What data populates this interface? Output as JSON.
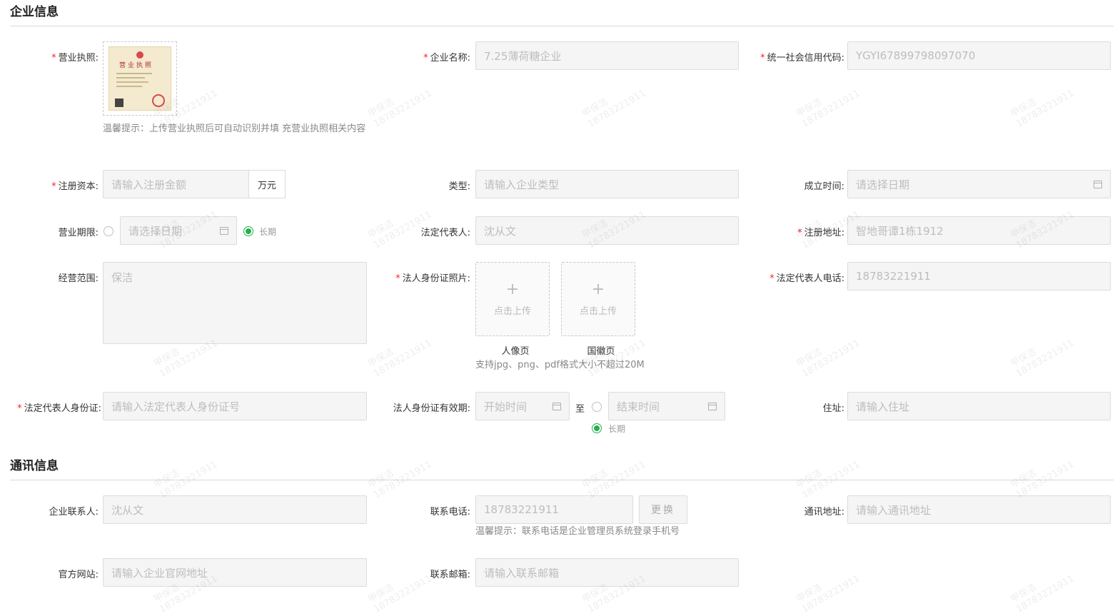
{
  "sections": {
    "company_info": "企业信息",
    "contact_info": "通讯信息"
  },
  "fields": {
    "business_license": {
      "label": "营业执照:",
      "hint": "温馨提示：上传营业执照后可自动识别并填 充营业执照相关内容",
      "seal_text": "营业执照"
    },
    "company_name": {
      "label": "企业名称:",
      "value": "7.25薄荷糖企业"
    },
    "credit_code": {
      "label": "统一社会信用代码:",
      "value": "YGYI67899798097070"
    },
    "registered_capital": {
      "label": "注册资本:",
      "placeholder": "请输入注册金额",
      "unit": "万元"
    },
    "company_type": {
      "label": "类型:",
      "placeholder": "请输入企业类型"
    },
    "founded_date": {
      "label": "成立时间:",
      "placeholder": "请选择日期"
    },
    "business_term": {
      "label": "营业期限:",
      "placeholder": "请选择日期",
      "long_term_label": "长期",
      "selected": "long_term"
    },
    "legal_rep": {
      "label": "法定代表人:",
      "value": "沈从文"
    },
    "registered_address": {
      "label": "注册地址:",
      "value": "智地哥谭1栋1912"
    },
    "business_scope": {
      "label": "经营范围:",
      "value": "保洁"
    },
    "id_photos": {
      "label": "法人身份证照片:",
      "upload_text": "点击上传",
      "front_caption": "人像页",
      "back_caption": "国徽页",
      "hint": "支持jpg、png、pdf格式大小不超过20M"
    },
    "legal_rep_phone": {
      "label": "法定代表人电话:",
      "value": "18783221911"
    },
    "legal_rep_id": {
      "label": "法定代表人身份证:",
      "placeholder": "请输入法定代表人身份证号"
    },
    "id_validity": {
      "label": "法人身份证有效期:",
      "start_placeholder": "开始时间",
      "to": "至",
      "end_placeholder": "结束时间",
      "long_term_label": "长期",
      "selected": "long_term"
    },
    "residence": {
      "label": "住址:",
      "placeholder": "请输入住址"
    },
    "contact_person": {
      "label": "企业联系人:",
      "value": "沈从文"
    },
    "contact_phone": {
      "label": "联系电话:",
      "value": "18783221911",
      "change_button": "更换",
      "hint": "温馨提示：联系电话是企业管理员系统登录手机号"
    },
    "mailing_address": {
      "label": "通讯地址:",
      "placeholder": "请输入通讯地址"
    },
    "website": {
      "label": "官方网站:",
      "placeholder": "请输入企业官网地址"
    },
    "email": {
      "label": "联系邮箱:",
      "placeholder": "请输入联系邮箱"
    }
  },
  "watermark": {
    "name": "甲保洁",
    "number": "18783221911"
  },
  "colors": {
    "required": "#f5222d",
    "accent": "#21b14b",
    "input_bg": "#f5f5f5"
  }
}
